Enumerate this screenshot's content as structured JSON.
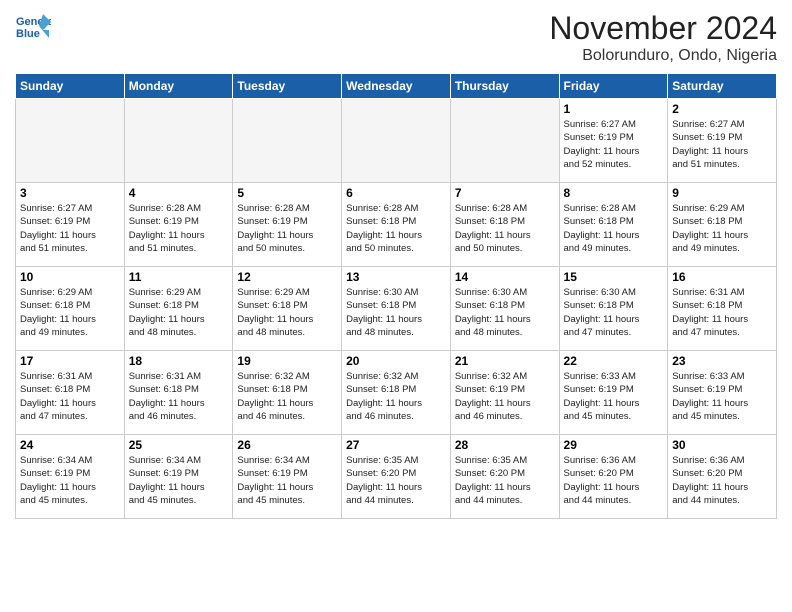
{
  "logo": {
    "line1": "General",
    "line2": "Blue"
  },
  "title": "November 2024",
  "location": "Bolorunduro, Ondo, Nigeria",
  "weekdays": [
    "Sunday",
    "Monday",
    "Tuesday",
    "Wednesday",
    "Thursday",
    "Friday",
    "Saturday"
  ],
  "weeks": [
    [
      {
        "day": "",
        "info": ""
      },
      {
        "day": "",
        "info": ""
      },
      {
        "day": "",
        "info": ""
      },
      {
        "day": "",
        "info": ""
      },
      {
        "day": "",
        "info": ""
      },
      {
        "day": "1",
        "info": "Sunrise: 6:27 AM\nSunset: 6:19 PM\nDaylight: 11 hours\nand 52 minutes."
      },
      {
        "day": "2",
        "info": "Sunrise: 6:27 AM\nSunset: 6:19 PM\nDaylight: 11 hours\nand 51 minutes."
      }
    ],
    [
      {
        "day": "3",
        "info": "Sunrise: 6:27 AM\nSunset: 6:19 PM\nDaylight: 11 hours\nand 51 minutes."
      },
      {
        "day": "4",
        "info": "Sunrise: 6:28 AM\nSunset: 6:19 PM\nDaylight: 11 hours\nand 51 minutes."
      },
      {
        "day": "5",
        "info": "Sunrise: 6:28 AM\nSunset: 6:19 PM\nDaylight: 11 hours\nand 50 minutes."
      },
      {
        "day": "6",
        "info": "Sunrise: 6:28 AM\nSunset: 6:18 PM\nDaylight: 11 hours\nand 50 minutes."
      },
      {
        "day": "7",
        "info": "Sunrise: 6:28 AM\nSunset: 6:18 PM\nDaylight: 11 hours\nand 50 minutes."
      },
      {
        "day": "8",
        "info": "Sunrise: 6:28 AM\nSunset: 6:18 PM\nDaylight: 11 hours\nand 49 minutes."
      },
      {
        "day": "9",
        "info": "Sunrise: 6:29 AM\nSunset: 6:18 PM\nDaylight: 11 hours\nand 49 minutes."
      }
    ],
    [
      {
        "day": "10",
        "info": "Sunrise: 6:29 AM\nSunset: 6:18 PM\nDaylight: 11 hours\nand 49 minutes."
      },
      {
        "day": "11",
        "info": "Sunrise: 6:29 AM\nSunset: 6:18 PM\nDaylight: 11 hours\nand 48 minutes."
      },
      {
        "day": "12",
        "info": "Sunrise: 6:29 AM\nSunset: 6:18 PM\nDaylight: 11 hours\nand 48 minutes."
      },
      {
        "day": "13",
        "info": "Sunrise: 6:30 AM\nSunset: 6:18 PM\nDaylight: 11 hours\nand 48 minutes."
      },
      {
        "day": "14",
        "info": "Sunrise: 6:30 AM\nSunset: 6:18 PM\nDaylight: 11 hours\nand 48 minutes."
      },
      {
        "day": "15",
        "info": "Sunrise: 6:30 AM\nSunset: 6:18 PM\nDaylight: 11 hours\nand 47 minutes."
      },
      {
        "day": "16",
        "info": "Sunrise: 6:31 AM\nSunset: 6:18 PM\nDaylight: 11 hours\nand 47 minutes."
      }
    ],
    [
      {
        "day": "17",
        "info": "Sunrise: 6:31 AM\nSunset: 6:18 PM\nDaylight: 11 hours\nand 47 minutes."
      },
      {
        "day": "18",
        "info": "Sunrise: 6:31 AM\nSunset: 6:18 PM\nDaylight: 11 hours\nand 46 minutes."
      },
      {
        "day": "19",
        "info": "Sunrise: 6:32 AM\nSunset: 6:18 PM\nDaylight: 11 hours\nand 46 minutes."
      },
      {
        "day": "20",
        "info": "Sunrise: 6:32 AM\nSunset: 6:18 PM\nDaylight: 11 hours\nand 46 minutes."
      },
      {
        "day": "21",
        "info": "Sunrise: 6:32 AM\nSunset: 6:19 PM\nDaylight: 11 hours\nand 46 minutes."
      },
      {
        "day": "22",
        "info": "Sunrise: 6:33 AM\nSunset: 6:19 PM\nDaylight: 11 hours\nand 45 minutes."
      },
      {
        "day": "23",
        "info": "Sunrise: 6:33 AM\nSunset: 6:19 PM\nDaylight: 11 hours\nand 45 minutes."
      }
    ],
    [
      {
        "day": "24",
        "info": "Sunrise: 6:34 AM\nSunset: 6:19 PM\nDaylight: 11 hours\nand 45 minutes."
      },
      {
        "day": "25",
        "info": "Sunrise: 6:34 AM\nSunset: 6:19 PM\nDaylight: 11 hours\nand 45 minutes."
      },
      {
        "day": "26",
        "info": "Sunrise: 6:34 AM\nSunset: 6:19 PM\nDaylight: 11 hours\nand 45 minutes."
      },
      {
        "day": "27",
        "info": "Sunrise: 6:35 AM\nSunset: 6:20 PM\nDaylight: 11 hours\nand 44 minutes."
      },
      {
        "day": "28",
        "info": "Sunrise: 6:35 AM\nSunset: 6:20 PM\nDaylight: 11 hours\nand 44 minutes."
      },
      {
        "day": "29",
        "info": "Sunrise: 6:36 AM\nSunset: 6:20 PM\nDaylight: 11 hours\nand 44 minutes."
      },
      {
        "day": "30",
        "info": "Sunrise: 6:36 AM\nSunset: 6:20 PM\nDaylight: 11 hours\nand 44 minutes."
      }
    ]
  ]
}
